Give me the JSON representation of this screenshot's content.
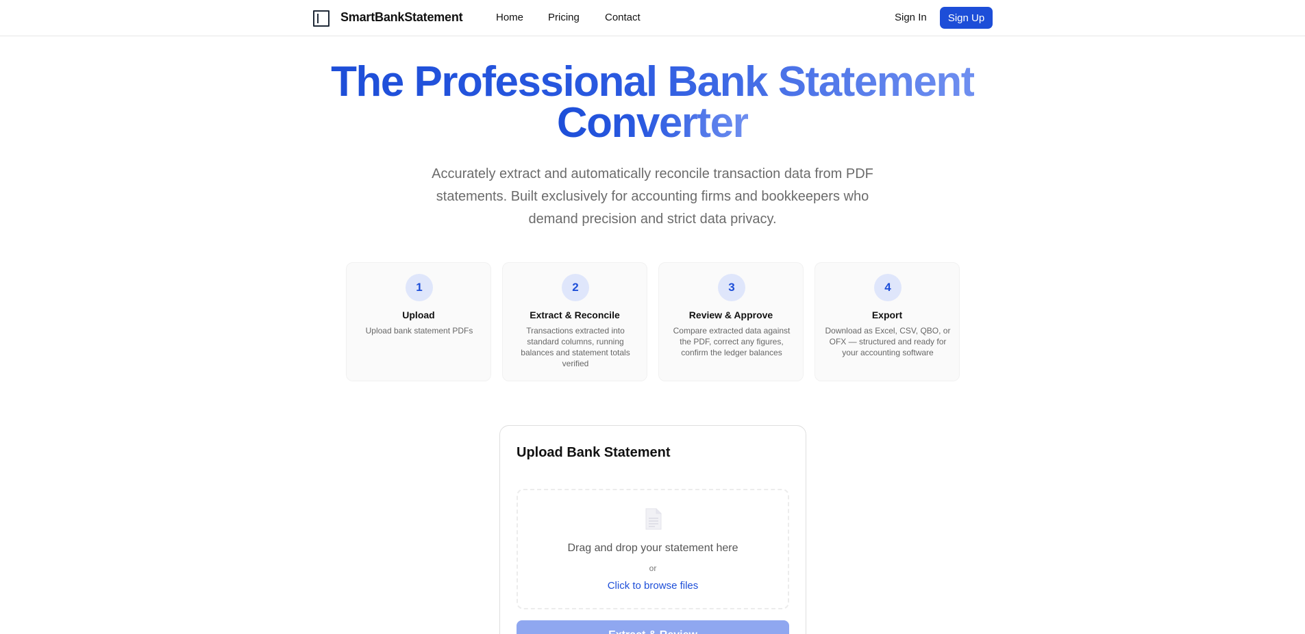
{
  "header": {
    "brand": "SmartBankStatement",
    "logo_icon": "square-bracket-logo-icon",
    "nav": {
      "home": "Home",
      "pricing": "Pricing",
      "contact": "Contact"
    },
    "sign_in": "Sign In",
    "sign_up": "Sign Up"
  },
  "hero": {
    "title_line1": "The Professional Bank Statement",
    "title_line2": "Converter",
    "subtitle": "Accurately extract and automatically reconcile transaction data from PDF statements. Built exclusively for accounting firms and bookkeepers who demand precision and strict data privacy."
  },
  "steps": [
    {
      "number": "1",
      "title": "Upload",
      "desc": "Upload bank statement PDFs"
    },
    {
      "number": "2",
      "title": "Extract & Reconcile",
      "desc": "Transactions extracted into standard columns, running balances and statement totals verified"
    },
    {
      "number": "3",
      "title": "Review & Approve",
      "desc": "Compare extracted data against the PDF, correct any figures, confirm the ledger balances"
    },
    {
      "number": "4",
      "title": "Export",
      "desc": "Download as Excel, CSV, QBO, or OFX — structured and ready for your accounting software"
    }
  ],
  "upload": {
    "title": "Upload Bank Statement",
    "file_icon": "document-icon",
    "drop_text": "Drag and drop your statement here",
    "or": "or",
    "browse": "Click to browse files",
    "button": "Extract & Review"
  },
  "colors": {
    "accent": "#1d4ed8",
    "accent_light": "#dfe6fb",
    "button_disabled": "#8fa7f0",
    "muted_text": "#6b6b6b"
  }
}
